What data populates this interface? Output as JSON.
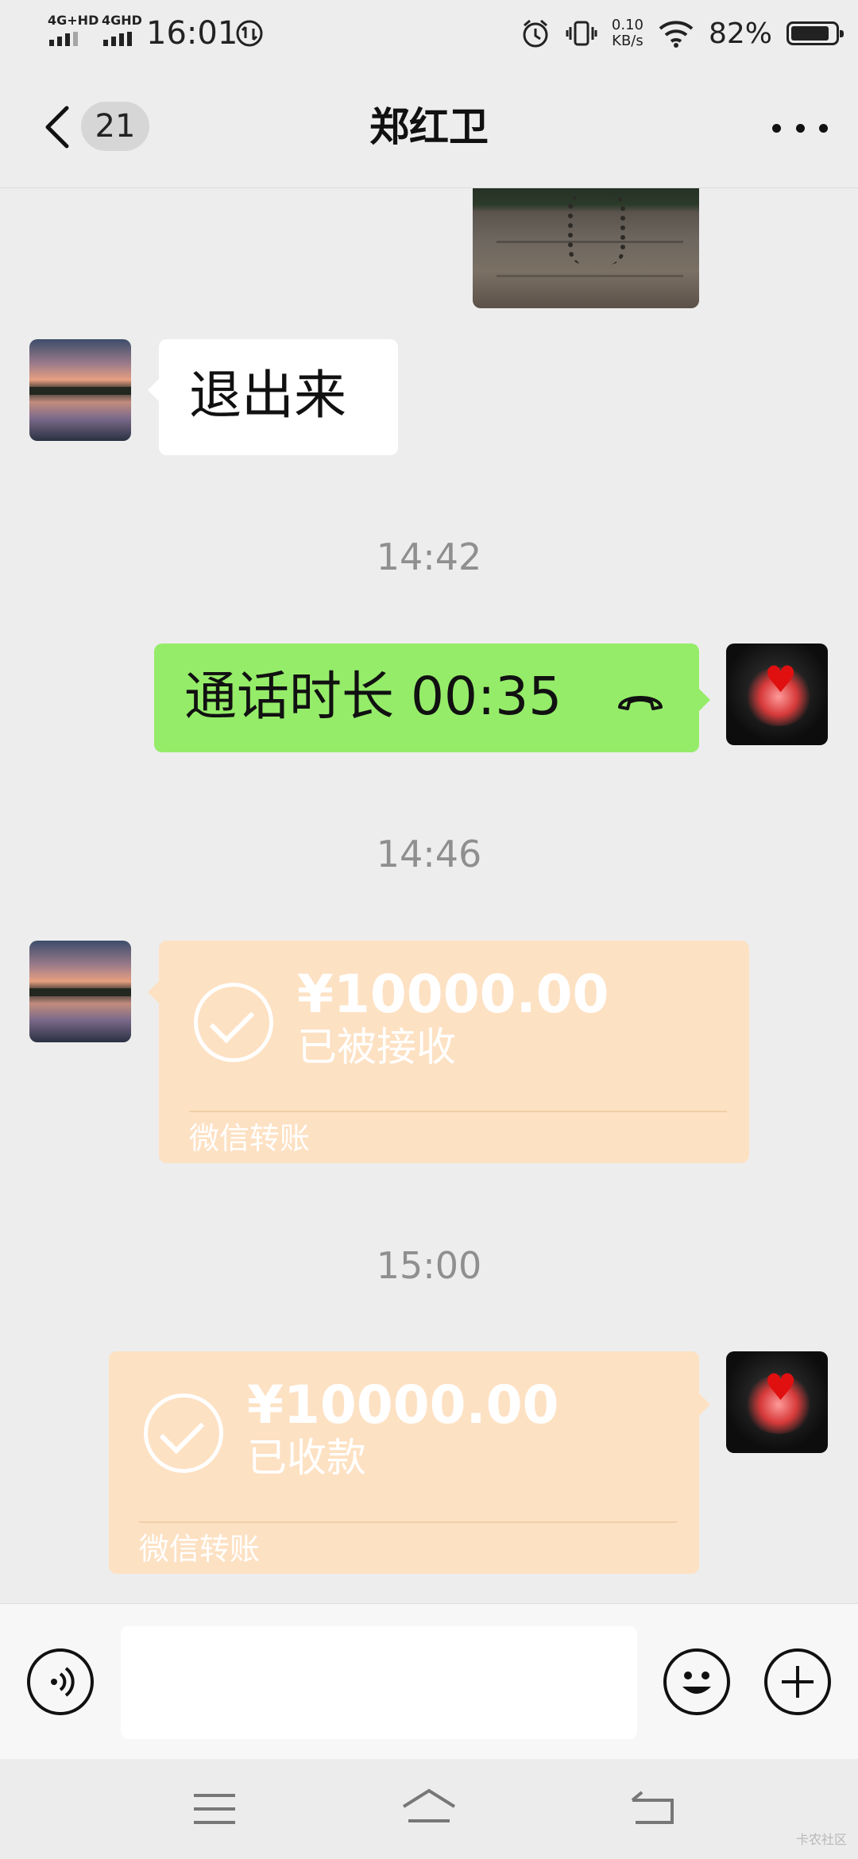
{
  "status_bar": {
    "sim1": "4G+HD",
    "sim2": "4GHD",
    "time": "16:01",
    "speed_value": "0.10",
    "speed_unit": "KB/s",
    "battery": "82%",
    "battery_level": 0.82,
    "icons": [
      "alarm-icon",
      "vibrate-icon",
      "wifi-icon",
      "battery-icon"
    ]
  },
  "header": {
    "unread_count": "21",
    "title": "郑红卫",
    "icons": [
      "back-arrow-icon",
      "more-icon"
    ]
  },
  "messages": {
    "m1_text": "退出来",
    "t1": "14:42",
    "m2_text": "通话时长 00:35",
    "t2": "14:46",
    "transfer1": {
      "amount": "¥10000.00",
      "status": "已被接收",
      "label": "微信转账"
    },
    "t3": "15:00",
    "transfer2": {
      "amount": "¥10000.00",
      "status": "已收款",
      "label": "微信转账"
    }
  },
  "input_bar": {
    "value": "",
    "icons": [
      "voice-icon",
      "emoji-icon",
      "plus-icon"
    ]
  },
  "nav_bar": {
    "icons": [
      "menu-icon",
      "home-icon",
      "back-icon"
    ]
  },
  "watermark": "卡农社区",
  "colors": {
    "background": "#ededed",
    "green_bubble": "#95ec69",
    "transfer_bubble": "#fde1c3",
    "timestamp": "#8f8f8f"
  }
}
